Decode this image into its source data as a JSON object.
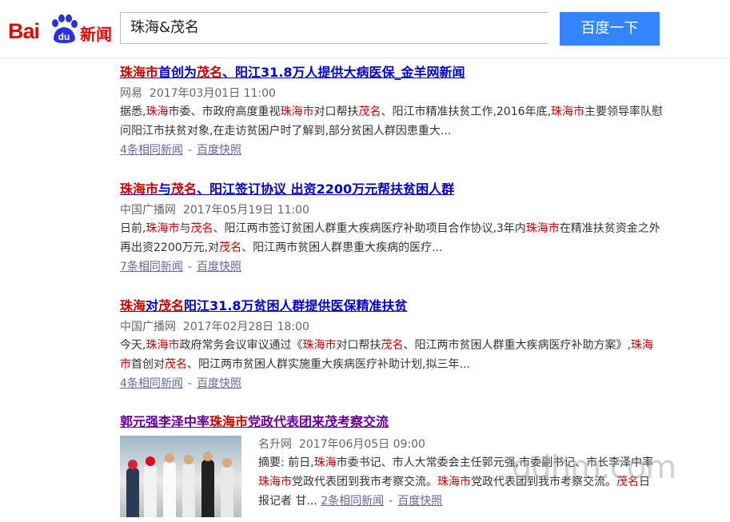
{
  "logo": {
    "brand_text_a": "Bai",
    "brand_text_b": "du",
    "product": "新闻"
  },
  "search": {
    "query": "珠海&茂名",
    "button_label": "百度一下"
  },
  "results": [
    {
      "title_parts": [
        {
          "t": "珠海市",
          "hl": true
        },
        {
          "t": "首创为",
          "hl": false
        },
        {
          "t": "茂名",
          "hl": true
        },
        {
          "t": "、阳江31.8万人提供大病医保_金羊网新闻",
          "hl": false
        }
      ],
      "source": "网易",
      "time": "2017年03月01日 11:00",
      "abstract": [
        {
          "t": "据悉,",
          "hl": false
        },
        {
          "t": "珠海",
          "hl": true
        },
        {
          "t": "市委、市政府高度重视",
          "hl": false
        },
        {
          "t": "珠海市",
          "hl": true
        },
        {
          "t": "对口帮扶",
          "hl": false
        },
        {
          "t": "茂名",
          "hl": true
        },
        {
          "t": "、阳江市精准扶贫工作,2016年底,",
          "hl": false
        },
        {
          "t": "珠海市",
          "hl": true
        },
        {
          "t": "主要领导率队慰问阳江市扶贫对象,在走访贫困户时了解到,部分贫困人群因患重大...",
          "hl": false
        }
      ],
      "related": "4条相同新闻",
      "snapshot": "百度快照"
    },
    {
      "title_parts": [
        {
          "t": "珠海市",
          "hl": true
        },
        {
          "t": "与",
          "hl": false
        },
        {
          "t": "茂名",
          "hl": true
        },
        {
          "t": "、阳江签订协议 出资2200万元帮扶贫困人群",
          "hl": false
        }
      ],
      "source": "中国广播网",
      "time": "2017年05月19日 11:00",
      "abstract": [
        {
          "t": "日前,",
          "hl": false
        },
        {
          "t": "珠海市",
          "hl": true
        },
        {
          "t": "与",
          "hl": false
        },
        {
          "t": "茂名",
          "hl": true
        },
        {
          "t": "、阳江两市签订贫困人群重大疾病医疗补助项目合作协议,3年内",
          "hl": false
        },
        {
          "t": "珠海市",
          "hl": true
        },
        {
          "t": "在精准扶贫资金之外再出资2200万元,对",
          "hl": false
        },
        {
          "t": "茂名",
          "hl": true
        },
        {
          "t": "、阳江两市贫困人群患重大疾病的医疗...",
          "hl": false
        }
      ],
      "related": "7条相同新闻",
      "snapshot": "百度快照"
    },
    {
      "title_parts": [
        {
          "t": "珠海",
          "hl": true
        },
        {
          "t": "对",
          "hl": false
        },
        {
          "t": "茂名",
          "hl": true
        },
        {
          "t": "阳江31.8万贫困人群提供医保精准扶贫",
          "hl": false
        }
      ],
      "source": "中国广播网",
      "time": "2017年02月28日 18:00",
      "abstract": [
        {
          "t": "今天,",
          "hl": false
        },
        {
          "t": "珠海市",
          "hl": true
        },
        {
          "t": "政府常务会议审议通过《",
          "hl": false
        },
        {
          "t": "珠海市",
          "hl": true
        },
        {
          "t": "对口帮扶",
          "hl": false
        },
        {
          "t": "茂名",
          "hl": true
        },
        {
          "t": "、阳江两市贫困人群重大疾病医疗补助方案》,",
          "hl": false
        },
        {
          "t": "珠海市",
          "hl": true
        },
        {
          "t": "首创对",
          "hl": false
        },
        {
          "t": "茂名",
          "hl": true
        },
        {
          "t": "、阳江两市贫困人群实施重大疾病医疗补助计划,拟三年...",
          "hl": false
        }
      ],
      "related": "4条相同新闻",
      "snapshot": "百度快照"
    },
    {
      "title_parts": [
        {
          "t": "郭元强李泽中率",
          "hl": false
        },
        {
          "t": "珠海市",
          "hl": true
        },
        {
          "t": "党政代表团来茂考察交流",
          "hl": false
        }
      ],
      "source": "名升网",
      "time": "2017年06月05日 09:00",
      "abstract": [
        {
          "t": "摘要: 前日,",
          "hl": false
        },
        {
          "t": "珠海",
          "hl": true
        },
        {
          "t": "市委书记、市人大常委会主任郭元强,市委副书记、市长李泽中率",
          "hl": false
        },
        {
          "t": "珠海市",
          "hl": true
        },
        {
          "t": "党政代表团到我市考察交流。",
          "hl": false
        },
        {
          "t": "珠海市",
          "hl": true
        },
        {
          "t": "党政代表团到我市考察交流。",
          "hl": false
        },
        {
          "t": "茂名",
          "hl": true
        },
        {
          "t": "日报记者 甘...",
          "hl": false
        }
      ],
      "related": "2条相同新闻",
      "snapshot": "百度快照"
    }
  ],
  "watermark": "gdhm.com"
}
